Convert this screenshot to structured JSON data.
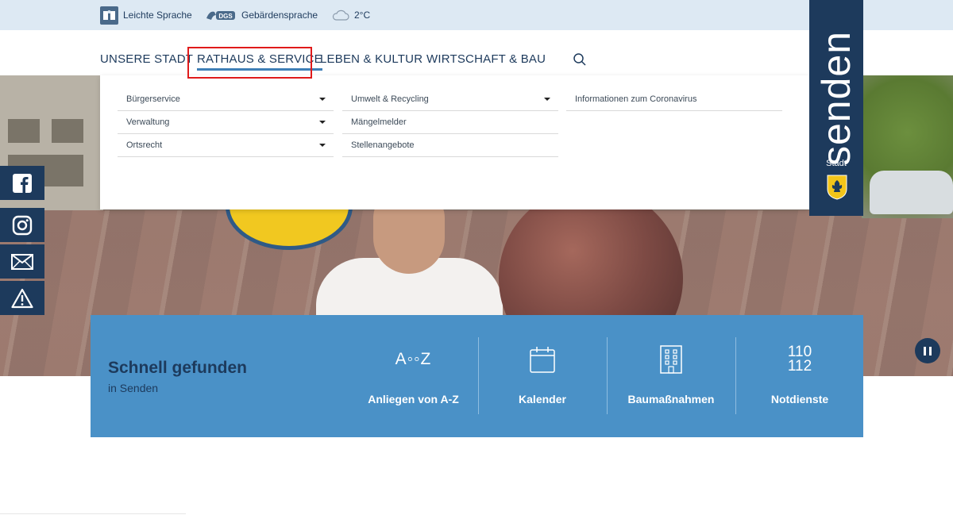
{
  "utility": {
    "easy_language": "Leichte Sprache",
    "sign_language": "Gebärdensprache",
    "dgs_badge": "DGS",
    "weather": "2°C"
  },
  "nav": {
    "items": [
      {
        "label": "UNSERE STADT"
      },
      {
        "label": "RATHAUS & SERVICE",
        "active": true
      },
      {
        "label": "LEBEN & KULTUR"
      },
      {
        "label": "WIRTSCHAFT & BAU"
      }
    ],
    "search_icon": "search-icon"
  },
  "mega_menu": {
    "col1": [
      {
        "label": "Bürgerservice",
        "has_submenu": true
      },
      {
        "label": "Verwaltung",
        "has_submenu": true
      },
      {
        "label": "Ortsrecht",
        "has_submenu": true
      }
    ],
    "col2": [
      {
        "label": "Umwelt & Recycling",
        "has_submenu": true
      },
      {
        "label": "Mängelmelder"
      },
      {
        "label": "Stellenangebote"
      }
    ],
    "col3": [
      {
        "label": "Informationen zum Coronavirus"
      }
    ]
  },
  "logo": {
    "name": "senden",
    "sub": "Stadt"
  },
  "social": [
    "facebook-icon",
    "instagram-icon",
    "mail-icon",
    "warning-icon"
  ],
  "quick": {
    "title": "Schnell gefunden",
    "subtitle": "in Senden",
    "tiles": [
      {
        "label": "Anliegen von A-Z",
        "icon_text": "A◦◦Z",
        "icon": "a-z-icon"
      },
      {
        "label": "Kalender",
        "icon": "calendar-icon"
      },
      {
        "label": "Baumaßnahmen",
        "icon": "building-icon"
      },
      {
        "label": "Notdienste",
        "icon_line1": "110",
        "icon_line2": "112",
        "icon": "emergency-numbers-icon"
      }
    ]
  },
  "colors": {
    "primary": "#1d3a5c",
    "accent": "#4a91c7",
    "highlight": "#e01b1b"
  }
}
